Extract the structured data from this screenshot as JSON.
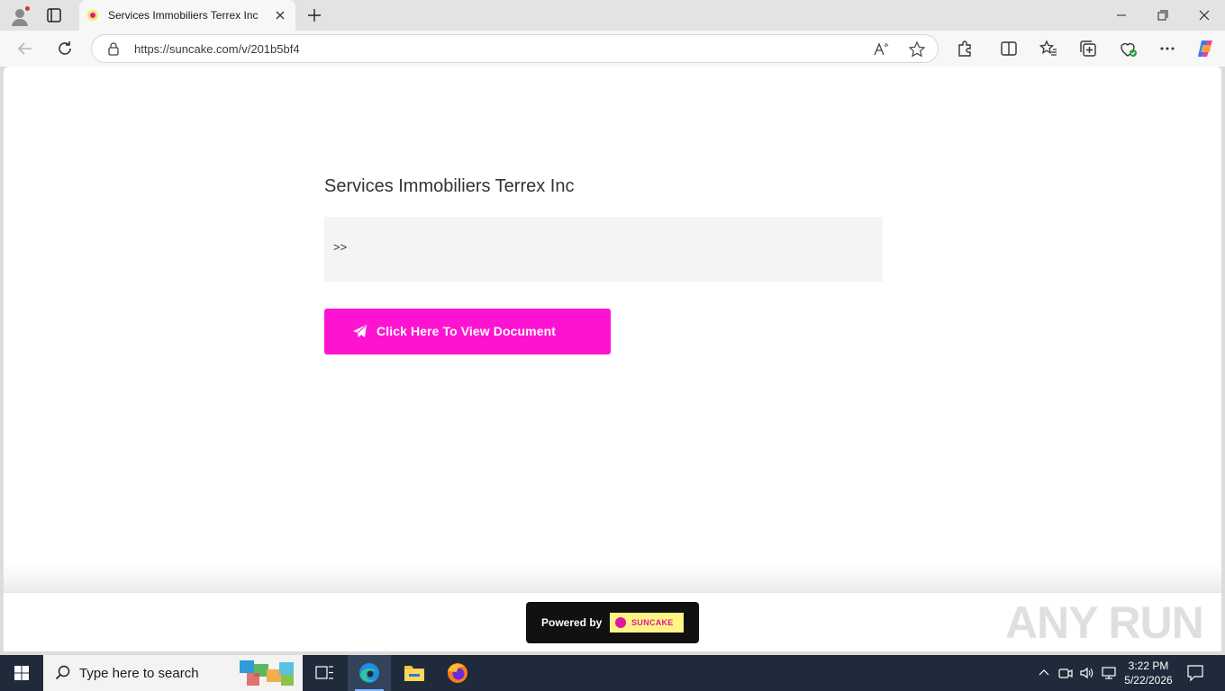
{
  "browser": {
    "tab_title": "Services Immobiliers Terrex Inc",
    "address_url": "https://suncake.com/v/201b5bf4"
  },
  "page": {
    "title": "Services Immobiliers Terrex Inc",
    "message": ">>",
    "cta_label": "Click Here To View Document",
    "cta_color": "#ff13d2",
    "powered_by_label": "Powered by",
    "brand_name": "SUNCAKE",
    "watermark": "ANY RUN"
  },
  "taskbar": {
    "search_placeholder": "Type here to search",
    "time": "3:22 PM",
    "date": "5/22/2026"
  }
}
